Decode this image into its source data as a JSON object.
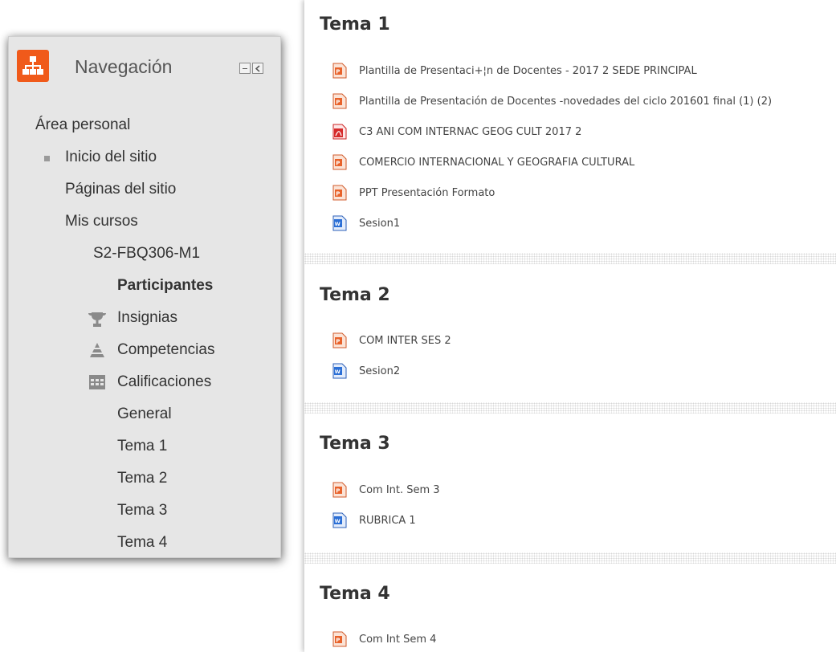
{
  "navigation": {
    "title": "Navegación",
    "icon": "sitemap-icon",
    "items": [
      {
        "label": "Área personal"
      },
      {
        "label": "Inicio del sitio"
      },
      {
        "label": "Páginas del sitio"
      },
      {
        "label": "Mis cursos"
      },
      {
        "label": "S2-FBQ306-M1"
      },
      {
        "label": "Participantes"
      },
      {
        "label": "Insignias",
        "icon": "trophy-icon"
      },
      {
        "label": "Competencias",
        "icon": "competency-icon"
      },
      {
        "label": "Calificaciones",
        "icon": "grades-table-icon"
      },
      {
        "label": "General"
      },
      {
        "label": "Tema 1"
      },
      {
        "label": "Tema 2"
      },
      {
        "label": "Tema 3"
      },
      {
        "label": "Tema 4"
      }
    ]
  },
  "sections": [
    {
      "title": "Tema 1",
      "activities": [
        {
          "name": "Plantilla de Presentaci+¦n de Docentes - 2017 2 SEDE PRINCIPAL",
          "icon": "powerpoint-icon"
        },
        {
          "name": "Plantilla de Presentación de Docentes -novedades del ciclo 201601 final (1) (2)",
          "icon": "powerpoint-icon"
        },
        {
          "name": "C3 ANI COM INTERNAC GEOG CULT 2017 2",
          "icon": "pdf-icon"
        },
        {
          "name": "COMERCIO INTERNACIONAL Y GEOGRAFIA CULTURAL",
          "icon": "powerpoint-icon"
        },
        {
          "name": "PPT Presentación Formato",
          "icon": "powerpoint-icon"
        },
        {
          "name": "Sesion1",
          "icon": "word-icon"
        }
      ]
    },
    {
      "title": "Tema 2",
      "activities": [
        {
          "name": "COM INTER SES 2",
          "icon": "powerpoint-icon"
        },
        {
          "name": "Sesion2",
          "icon": "word-icon"
        }
      ]
    },
    {
      "title": "Tema 3",
      "activities": [
        {
          "name": "Com Int. Sem 3",
          "icon": "powerpoint-icon"
        },
        {
          "name": "RUBRICA 1",
          "icon": "word-icon"
        }
      ]
    },
    {
      "title": "Tema 4",
      "activities": [
        {
          "name": "Com Int Sem 4",
          "icon": "powerpoint-icon"
        }
      ]
    }
  ],
  "colors": {
    "nav_logo": "#f05a1a",
    "nav_background": "#e6e6e6",
    "text": "#333333",
    "pdf": "#d62b2b",
    "word": "#2b6fd6"
  }
}
